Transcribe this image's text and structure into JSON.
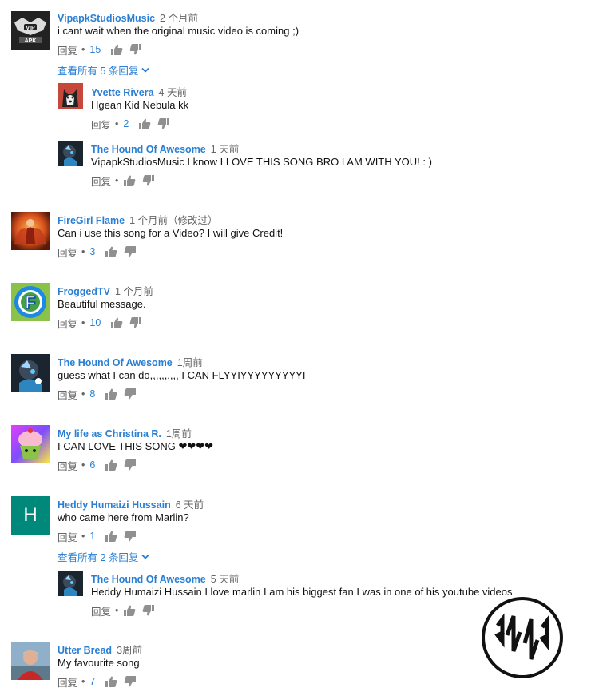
{
  "ui": {
    "reply_label": "回复",
    "separator": "•"
  },
  "colors": {
    "link_blue": "#2a7fd4",
    "meta_grey": "#666666",
    "icon_grey": "#909090"
  },
  "comments": [
    {
      "id": "c1",
      "author": "VipapkStudiosMusic",
      "time": "2 个月前",
      "text": "i cant wait when the original music video is coming ;)",
      "likes": "15",
      "avatar": "vip-apk-logo",
      "view_replies": "查看所有 5 条回复",
      "replies": [
        {
          "id": "r1",
          "author": "Yvette Rivera",
          "time": "4 天前",
          "text": "Hgean Kid Nebula kk",
          "likes": "2",
          "avatar": "husky-photo"
        },
        {
          "id": "r2",
          "author": "The Hound Of Awesome",
          "time": "1 天前",
          "text": "VipapkStudiosMusic I know I LOVE THIS SONG BRO I AM WITH YOU! : )",
          "likes": "",
          "avatar": "hound-avatar"
        }
      ]
    },
    {
      "id": "c2",
      "author": "FireGirl Flame",
      "time": "1 个月前（修改过）",
      "text": "Can i use this song for a Video? I will give Credit!",
      "likes": "3",
      "avatar": "fire-girl-avatar"
    },
    {
      "id": "c3",
      "author": "FroggedTV",
      "time": "1 个月前",
      "text": "Beautiful message.",
      "likes": "10",
      "avatar": "frogged-logo"
    },
    {
      "id": "c4",
      "author": "The Hound Of Awesome",
      "time": "1周前",
      "text": "guess what I can do,,,,,,,,,, I CAN FLYYIYYYYYYYYYI",
      "likes": "8",
      "avatar": "hound-avatar"
    },
    {
      "id": "c5",
      "author": "My life as Christina R.",
      "time": "1周前",
      "text": "I CAN LOVE THIS SONG ❤❤❤❤",
      "likes": "6",
      "avatar": "cupcake-avatar"
    },
    {
      "id": "c6",
      "author": "Heddy Humaizi Hussain",
      "time": "6 天前",
      "text": "who came here from Marlin?",
      "likes": "1",
      "avatar": "letter-h",
      "avatar_letter": "H",
      "view_replies": "查看所有 2 条回复",
      "replies": [
        {
          "id": "r3",
          "author": "The Hound Of Awesome",
          "time": "5 天前",
          "text": "Heddy Humaizi Hussain I love marlin I am his biggest fan I was in one of his youtube videos",
          "likes": "",
          "avatar": "hound-avatar"
        }
      ]
    },
    {
      "id": "c7",
      "author": "Utter Bread",
      "time": "3周前",
      "text": "My favourite song",
      "likes": "7",
      "avatar": "man-photo"
    }
  ]
}
